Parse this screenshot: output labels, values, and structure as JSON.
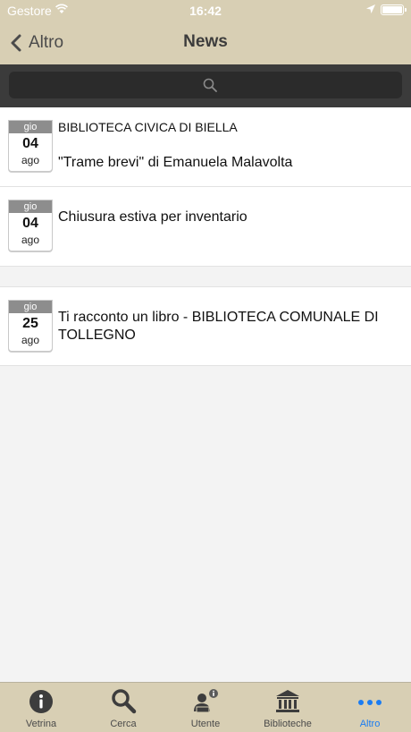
{
  "status_bar": {
    "carrier": "Gestore",
    "time": "16:42"
  },
  "nav": {
    "back_label": "Altro",
    "title": "News"
  },
  "news": [
    {
      "day": "gio",
      "date": "04",
      "month": "ago",
      "category": "BIBLIOTECA CIVICA DI BIELLA",
      "title": "\"Trame brevi\" di Emanuela Malavolta"
    },
    {
      "day": "gio",
      "date": "04",
      "month": "ago",
      "category": "",
      "title": "Chiusura estiva per inventario"
    },
    {
      "day": "gio",
      "date": "25",
      "month": "ago",
      "category": "",
      "title": "Ti racconto un libro - BIBLIOTECA COMUNALE DI TOLLEGNO"
    }
  ],
  "tabs": [
    {
      "label": "Vetrina",
      "icon": "info-icon"
    },
    {
      "label": "Cerca",
      "icon": "magnifier-icon"
    },
    {
      "label": "Utente",
      "icon": "user-icon"
    },
    {
      "label": "Biblioteche",
      "icon": "library-icon"
    },
    {
      "label": "Altro",
      "icon": "more-icon",
      "active": true
    }
  ],
  "colors": {
    "header": "#d8cfb4",
    "search_bg": "#3b3b3b",
    "active_tab": "#1a7cf2"
  }
}
